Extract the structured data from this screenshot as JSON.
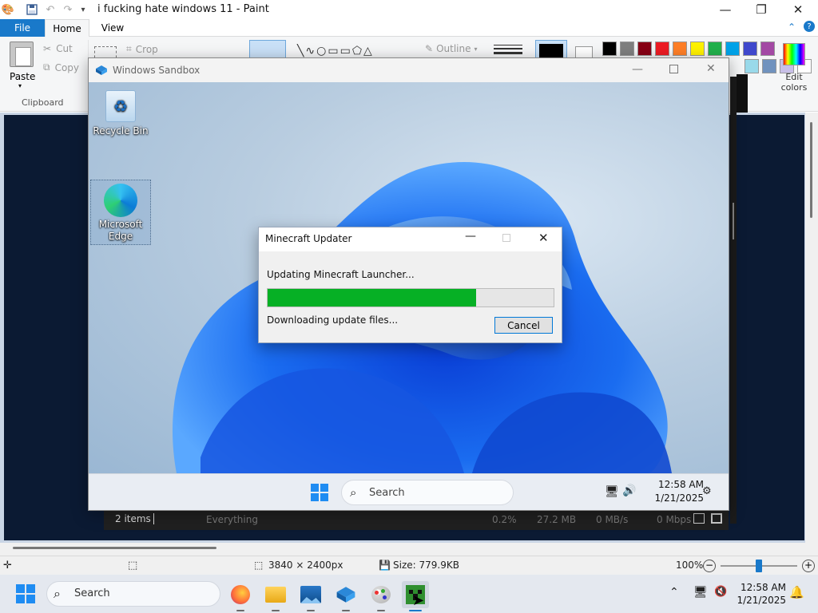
{
  "paint": {
    "title": "i fucking hate windows 11 - Paint",
    "tabs": [
      "File",
      "Home",
      "View"
    ],
    "ribbon": {
      "paste": "Paste",
      "cut": "Cut",
      "copy": "Copy",
      "crop": "Crop",
      "outline": "Outline",
      "clipboard_group": "Clipboard",
      "edit_colors": "Edit colors"
    },
    "palette": [
      "#000000",
      "#7f7f7f",
      "#880015",
      "#ed1c24",
      "#ff7f27",
      "#fff200",
      "#22b14c",
      "#00a2e8",
      "#3f48cc",
      "#a349a4"
    ],
    "palette_row2": [
      "#99d9ea",
      "#7092be",
      "#c8bfe7",
      "#ffffff"
    ],
    "status": {
      "dimensions": "3840 × 2400px",
      "size": "Size: 779.9KB",
      "zoom": "100%"
    }
  },
  "background_window": {
    "items_count": "2 items",
    "process_name": "Everything",
    "cpu": "0.2%",
    "memory": "27.2 MB",
    "disk": "0 MB/s",
    "network": "0 Mbps"
  },
  "sandbox": {
    "title": "Windows Sandbox",
    "desktop_icons": [
      {
        "label": "Recycle Bin"
      },
      {
        "label": "Microsoft Edge"
      }
    ],
    "taskbar": {
      "search_placeholder": "Search",
      "time": "12:58 AM",
      "date": "1/21/2025"
    }
  },
  "dialog": {
    "title": "Minecraft Updater",
    "status": "Updating Minecraft Launcher...",
    "progress": 0.73,
    "detail": "Downloading update files...",
    "cancel_label": "Cancel"
  },
  "taskbar": {
    "search_label": "Search",
    "time": "12:58 AM",
    "date": "1/21/2025",
    "apps": [
      "firefox-icon",
      "file-explorer-icon",
      "photos-icon",
      "sandbox-icon",
      "paint-icon",
      "minecraft-icon"
    ]
  },
  "colors": {
    "accent": "#1979ca",
    "progress": "#06b025",
    "taskbar": "#e4e8ef"
  }
}
